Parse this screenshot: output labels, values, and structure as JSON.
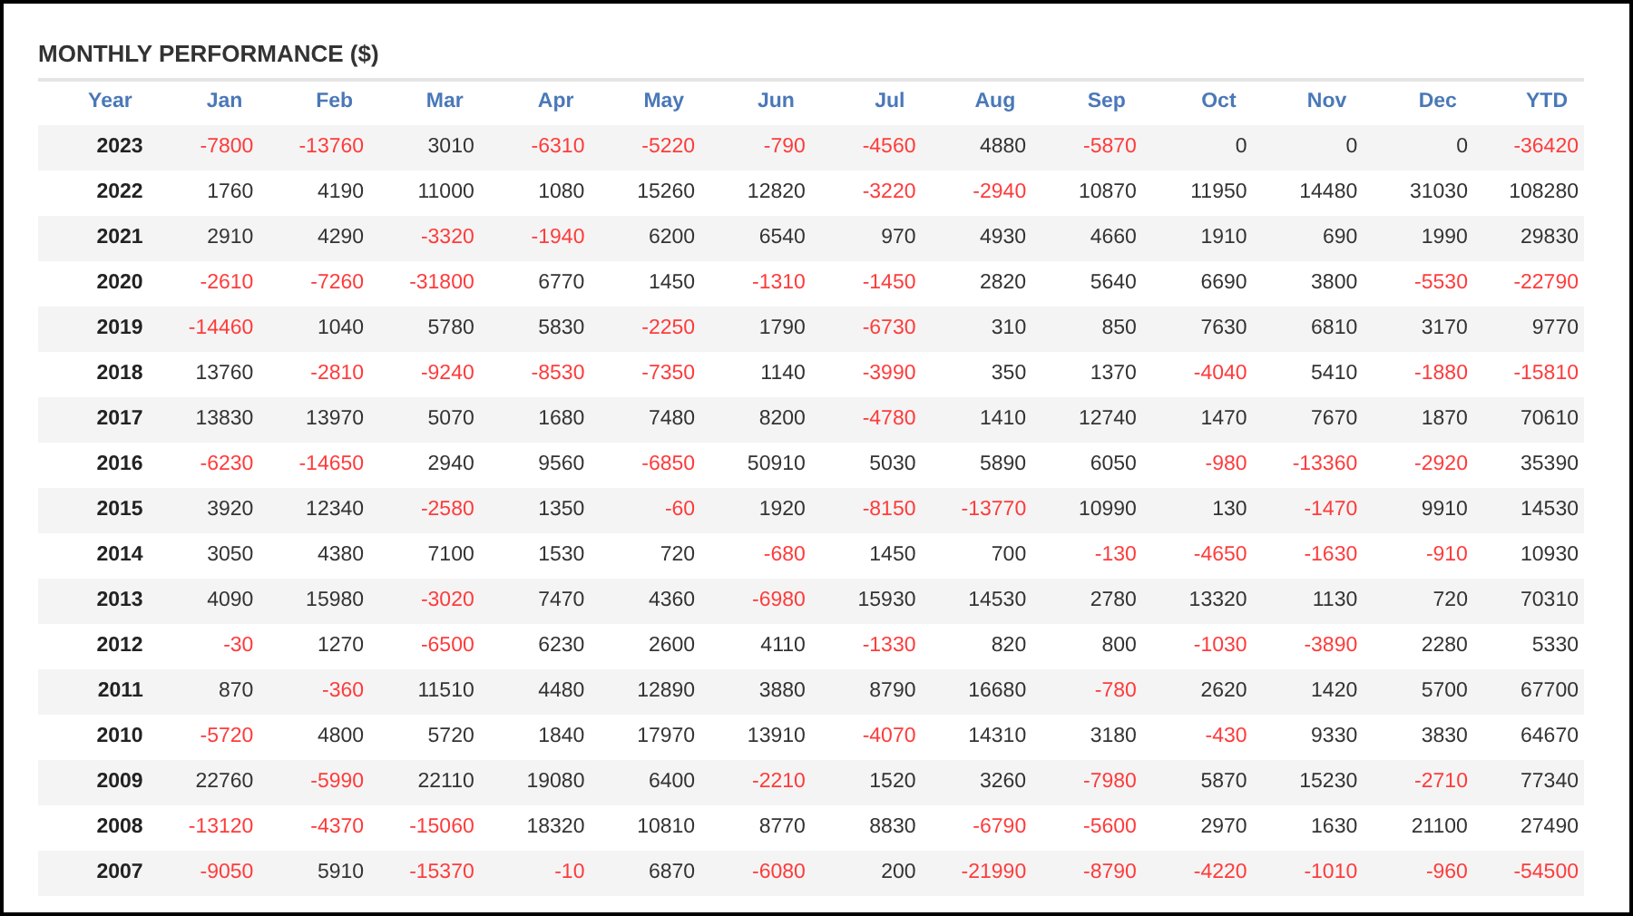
{
  "title": "MONTHLY PERFORMANCE ($)",
  "table": {
    "columns": [
      "Year",
      "Jan",
      "Feb",
      "Mar",
      "Apr",
      "May",
      "Jun",
      "Jul",
      "Aug",
      "Sep",
      "Oct",
      "Nov",
      "Dec",
      "YTD"
    ],
    "rows": [
      {
        "cells": [
          {
            "kind": "year",
            "value": "2023"
          },
          {
            "kind": "amount",
            "value": "-7800",
            "negative": true
          },
          {
            "kind": "amount",
            "value": "-13760",
            "negative": true
          },
          {
            "kind": "amount",
            "value": "3010",
            "negative": false
          },
          {
            "kind": "amount",
            "value": "-6310",
            "negative": true
          },
          {
            "kind": "amount",
            "value": "-5220",
            "negative": true
          },
          {
            "kind": "amount",
            "value": "-790",
            "negative": true
          },
          {
            "kind": "amount",
            "value": "-4560",
            "negative": true
          },
          {
            "kind": "amount",
            "value": "4880",
            "negative": false
          },
          {
            "kind": "amount",
            "value": "-5870",
            "negative": true
          },
          {
            "kind": "amount",
            "value": "0",
            "negative": false
          },
          {
            "kind": "amount",
            "value": "0",
            "negative": false
          },
          {
            "kind": "amount",
            "value": "0",
            "negative": false
          },
          {
            "kind": "amount",
            "value": "-36420",
            "negative": true
          }
        ]
      },
      {
        "cells": [
          {
            "kind": "year",
            "value": "2022"
          },
          {
            "kind": "amount",
            "value": "1760",
            "negative": false
          },
          {
            "kind": "amount",
            "value": "4190",
            "negative": false
          },
          {
            "kind": "amount",
            "value": "11000",
            "negative": false
          },
          {
            "kind": "amount",
            "value": "1080",
            "negative": false
          },
          {
            "kind": "amount",
            "value": "15260",
            "negative": false
          },
          {
            "kind": "amount",
            "value": "12820",
            "negative": false
          },
          {
            "kind": "amount",
            "value": "-3220",
            "negative": true
          },
          {
            "kind": "amount",
            "value": "-2940",
            "negative": true
          },
          {
            "kind": "amount",
            "value": "10870",
            "negative": false
          },
          {
            "kind": "amount",
            "value": "11950",
            "negative": false
          },
          {
            "kind": "amount",
            "value": "14480",
            "negative": false
          },
          {
            "kind": "amount",
            "value": "31030",
            "negative": false
          },
          {
            "kind": "amount",
            "value": "108280",
            "negative": false
          }
        ]
      },
      {
        "cells": [
          {
            "kind": "year",
            "value": "2021"
          },
          {
            "kind": "amount",
            "value": "2910",
            "negative": false
          },
          {
            "kind": "amount",
            "value": "4290",
            "negative": false
          },
          {
            "kind": "amount",
            "value": "-3320",
            "negative": true
          },
          {
            "kind": "amount",
            "value": "-1940",
            "negative": true
          },
          {
            "kind": "amount",
            "value": "6200",
            "negative": false
          },
          {
            "kind": "amount",
            "value": "6540",
            "negative": false
          },
          {
            "kind": "amount",
            "value": "970",
            "negative": false
          },
          {
            "kind": "amount",
            "value": "4930",
            "negative": false
          },
          {
            "kind": "amount",
            "value": "4660",
            "negative": false
          },
          {
            "kind": "amount",
            "value": "1910",
            "negative": false
          },
          {
            "kind": "amount",
            "value": "690",
            "negative": false
          },
          {
            "kind": "amount",
            "value": "1990",
            "negative": false
          },
          {
            "kind": "amount",
            "value": "29830",
            "negative": false
          }
        ]
      },
      {
        "cells": [
          {
            "kind": "year",
            "value": "2020"
          },
          {
            "kind": "amount",
            "value": "-2610",
            "negative": true
          },
          {
            "kind": "amount",
            "value": "-7260",
            "negative": true
          },
          {
            "kind": "amount",
            "value": "-31800",
            "negative": true
          },
          {
            "kind": "amount",
            "value": "6770",
            "negative": false
          },
          {
            "kind": "amount",
            "value": "1450",
            "negative": false
          },
          {
            "kind": "amount",
            "value": "-1310",
            "negative": true
          },
          {
            "kind": "amount",
            "value": "-1450",
            "negative": true
          },
          {
            "kind": "amount",
            "value": "2820",
            "negative": false
          },
          {
            "kind": "amount",
            "value": "5640",
            "negative": false
          },
          {
            "kind": "amount",
            "value": "6690",
            "negative": false
          },
          {
            "kind": "amount",
            "value": "3800",
            "negative": false
          },
          {
            "kind": "amount",
            "value": "-5530",
            "negative": true
          },
          {
            "kind": "amount",
            "value": "-22790",
            "negative": true
          }
        ]
      },
      {
        "cells": [
          {
            "kind": "year",
            "value": "2019"
          },
          {
            "kind": "amount",
            "value": "-14460",
            "negative": true
          },
          {
            "kind": "amount",
            "value": "1040",
            "negative": false
          },
          {
            "kind": "amount",
            "value": "5780",
            "negative": false
          },
          {
            "kind": "amount",
            "value": "5830",
            "negative": false
          },
          {
            "kind": "amount",
            "value": "-2250",
            "negative": true
          },
          {
            "kind": "amount",
            "value": "1790",
            "negative": false
          },
          {
            "kind": "amount",
            "value": "-6730",
            "negative": true
          },
          {
            "kind": "amount",
            "value": "310",
            "negative": false
          },
          {
            "kind": "amount",
            "value": "850",
            "negative": false
          },
          {
            "kind": "amount",
            "value": "7630",
            "negative": false
          },
          {
            "kind": "amount",
            "value": "6810",
            "negative": false
          },
          {
            "kind": "amount",
            "value": "3170",
            "negative": false
          },
          {
            "kind": "amount",
            "value": "9770",
            "negative": false
          }
        ]
      },
      {
        "cells": [
          {
            "kind": "year",
            "value": "2018"
          },
          {
            "kind": "amount",
            "value": "13760",
            "negative": false
          },
          {
            "kind": "amount",
            "value": "-2810",
            "negative": true
          },
          {
            "kind": "amount",
            "value": "-9240",
            "negative": true
          },
          {
            "kind": "amount",
            "value": "-8530",
            "negative": true
          },
          {
            "kind": "amount",
            "value": "-7350",
            "negative": true
          },
          {
            "kind": "amount",
            "value": "1140",
            "negative": false
          },
          {
            "kind": "amount",
            "value": "-3990",
            "negative": true
          },
          {
            "kind": "amount",
            "value": "350",
            "negative": false
          },
          {
            "kind": "amount",
            "value": "1370",
            "negative": false
          },
          {
            "kind": "amount",
            "value": "-4040",
            "negative": true
          },
          {
            "kind": "amount",
            "value": "5410",
            "negative": false
          },
          {
            "kind": "amount",
            "value": "-1880",
            "negative": true
          },
          {
            "kind": "amount",
            "value": "-15810",
            "negative": true
          }
        ]
      },
      {
        "cells": [
          {
            "kind": "year",
            "value": "2017"
          },
          {
            "kind": "amount",
            "value": "13830",
            "negative": false
          },
          {
            "kind": "amount",
            "value": "13970",
            "negative": false
          },
          {
            "kind": "amount",
            "value": "5070",
            "negative": false
          },
          {
            "kind": "amount",
            "value": "1680",
            "negative": false
          },
          {
            "kind": "amount",
            "value": "7480",
            "negative": false
          },
          {
            "kind": "amount",
            "value": "8200",
            "negative": false
          },
          {
            "kind": "amount",
            "value": "-4780",
            "negative": true
          },
          {
            "kind": "amount",
            "value": "1410",
            "negative": false
          },
          {
            "kind": "amount",
            "value": "12740",
            "negative": false
          },
          {
            "kind": "amount",
            "value": "1470",
            "negative": false
          },
          {
            "kind": "amount",
            "value": "7670",
            "negative": false
          },
          {
            "kind": "amount",
            "value": "1870",
            "negative": false
          },
          {
            "kind": "amount",
            "value": "70610",
            "negative": false
          }
        ]
      },
      {
        "cells": [
          {
            "kind": "year",
            "value": "2016"
          },
          {
            "kind": "amount",
            "value": "-6230",
            "negative": true
          },
          {
            "kind": "amount",
            "value": "-14650",
            "negative": true
          },
          {
            "kind": "amount",
            "value": "2940",
            "negative": false
          },
          {
            "kind": "amount",
            "value": "9560",
            "negative": false
          },
          {
            "kind": "amount",
            "value": "-6850",
            "negative": true
          },
          {
            "kind": "amount",
            "value": "50910",
            "negative": false
          },
          {
            "kind": "amount",
            "value": "5030",
            "negative": false
          },
          {
            "kind": "amount",
            "value": "5890",
            "negative": false
          },
          {
            "kind": "amount",
            "value": "6050",
            "negative": false
          },
          {
            "kind": "amount",
            "value": "-980",
            "negative": true
          },
          {
            "kind": "amount",
            "value": "-13360",
            "negative": true
          },
          {
            "kind": "amount",
            "value": "-2920",
            "negative": true
          },
          {
            "kind": "amount",
            "value": "35390",
            "negative": false
          }
        ]
      },
      {
        "cells": [
          {
            "kind": "year",
            "value": "2015"
          },
          {
            "kind": "amount",
            "value": "3920",
            "negative": false
          },
          {
            "kind": "amount",
            "value": "12340",
            "negative": false
          },
          {
            "kind": "amount",
            "value": "-2580",
            "negative": true
          },
          {
            "kind": "amount",
            "value": "1350",
            "negative": false
          },
          {
            "kind": "amount",
            "value": "-60",
            "negative": true
          },
          {
            "kind": "amount",
            "value": "1920",
            "negative": false
          },
          {
            "kind": "amount",
            "value": "-8150",
            "negative": true
          },
          {
            "kind": "amount",
            "value": "-13770",
            "negative": true
          },
          {
            "kind": "amount",
            "value": "10990",
            "negative": false
          },
          {
            "kind": "amount",
            "value": "130",
            "negative": false
          },
          {
            "kind": "amount",
            "value": "-1470",
            "negative": true
          },
          {
            "kind": "amount",
            "value": "9910",
            "negative": false
          },
          {
            "kind": "amount",
            "value": "14530",
            "negative": false
          }
        ]
      },
      {
        "cells": [
          {
            "kind": "year",
            "value": "2014"
          },
          {
            "kind": "amount",
            "value": "3050",
            "negative": false
          },
          {
            "kind": "amount",
            "value": "4380",
            "negative": false
          },
          {
            "kind": "amount",
            "value": "7100",
            "negative": false
          },
          {
            "kind": "amount",
            "value": "1530",
            "negative": false
          },
          {
            "kind": "amount",
            "value": "720",
            "negative": false
          },
          {
            "kind": "amount",
            "value": "-680",
            "negative": true
          },
          {
            "kind": "amount",
            "value": "1450",
            "negative": false
          },
          {
            "kind": "amount",
            "value": "700",
            "negative": false
          },
          {
            "kind": "amount",
            "value": "-130",
            "negative": true
          },
          {
            "kind": "amount",
            "value": "-4650",
            "negative": true
          },
          {
            "kind": "amount",
            "value": "-1630",
            "negative": true
          },
          {
            "kind": "amount",
            "value": "-910",
            "negative": true
          },
          {
            "kind": "amount",
            "value": "10930",
            "negative": false
          }
        ]
      },
      {
        "cells": [
          {
            "kind": "year",
            "value": "2013"
          },
          {
            "kind": "amount",
            "value": "4090",
            "negative": false
          },
          {
            "kind": "amount",
            "value": "15980",
            "negative": false
          },
          {
            "kind": "amount",
            "value": "-3020",
            "negative": true
          },
          {
            "kind": "amount",
            "value": "7470",
            "negative": false
          },
          {
            "kind": "amount",
            "value": "4360",
            "negative": false
          },
          {
            "kind": "amount",
            "value": "-6980",
            "negative": true
          },
          {
            "kind": "amount",
            "value": "15930",
            "negative": false
          },
          {
            "kind": "amount",
            "value": "14530",
            "negative": false
          },
          {
            "kind": "amount",
            "value": "2780",
            "negative": false
          },
          {
            "kind": "amount",
            "value": "13320",
            "negative": false
          },
          {
            "kind": "amount",
            "value": "1130",
            "negative": false
          },
          {
            "kind": "amount",
            "value": "720",
            "negative": false
          },
          {
            "kind": "amount",
            "value": "70310",
            "negative": false
          }
        ]
      },
      {
        "cells": [
          {
            "kind": "year",
            "value": "2012"
          },
          {
            "kind": "amount",
            "value": "-30",
            "negative": true
          },
          {
            "kind": "amount",
            "value": "1270",
            "negative": false
          },
          {
            "kind": "amount",
            "value": "-6500",
            "negative": true
          },
          {
            "kind": "amount",
            "value": "6230",
            "negative": false
          },
          {
            "kind": "amount",
            "value": "2600",
            "negative": false
          },
          {
            "kind": "amount",
            "value": "4110",
            "negative": false
          },
          {
            "kind": "amount",
            "value": "-1330",
            "negative": true
          },
          {
            "kind": "amount",
            "value": "820",
            "negative": false
          },
          {
            "kind": "amount",
            "value": "800",
            "negative": false
          },
          {
            "kind": "amount",
            "value": "-1030",
            "negative": true
          },
          {
            "kind": "amount",
            "value": "-3890",
            "negative": true
          },
          {
            "kind": "amount",
            "value": "2280",
            "negative": false
          },
          {
            "kind": "amount",
            "value": "5330",
            "negative": false
          }
        ]
      },
      {
        "cells": [
          {
            "kind": "year",
            "value": "2011"
          },
          {
            "kind": "amount",
            "value": "870",
            "negative": false
          },
          {
            "kind": "amount",
            "value": "-360",
            "negative": true
          },
          {
            "kind": "amount",
            "value": "11510",
            "negative": false
          },
          {
            "kind": "amount",
            "value": "4480",
            "negative": false
          },
          {
            "kind": "amount",
            "value": "12890",
            "negative": false
          },
          {
            "kind": "amount",
            "value": "3880",
            "negative": false
          },
          {
            "kind": "amount",
            "value": "8790",
            "negative": false
          },
          {
            "kind": "amount",
            "value": "16680",
            "negative": false
          },
          {
            "kind": "amount",
            "value": "-780",
            "negative": true
          },
          {
            "kind": "amount",
            "value": "2620",
            "negative": false
          },
          {
            "kind": "amount",
            "value": "1420",
            "negative": false
          },
          {
            "kind": "amount",
            "value": "5700",
            "negative": false
          },
          {
            "kind": "amount",
            "value": "67700",
            "negative": false
          }
        ]
      },
      {
        "cells": [
          {
            "kind": "year",
            "value": "2010"
          },
          {
            "kind": "amount",
            "value": "-5720",
            "negative": true
          },
          {
            "kind": "amount",
            "value": "4800",
            "negative": false
          },
          {
            "kind": "amount",
            "value": "5720",
            "negative": false
          },
          {
            "kind": "amount",
            "value": "1840",
            "negative": false
          },
          {
            "kind": "amount",
            "value": "17970",
            "negative": false
          },
          {
            "kind": "amount",
            "value": "13910",
            "negative": false
          },
          {
            "kind": "amount",
            "value": "-4070",
            "negative": true
          },
          {
            "kind": "amount",
            "value": "14310",
            "negative": false
          },
          {
            "kind": "amount",
            "value": "3180",
            "negative": false
          },
          {
            "kind": "amount",
            "value": "-430",
            "negative": true
          },
          {
            "kind": "amount",
            "value": "9330",
            "negative": false
          },
          {
            "kind": "amount",
            "value": "3830",
            "negative": false
          },
          {
            "kind": "amount",
            "value": "64670",
            "negative": false
          }
        ]
      },
      {
        "cells": [
          {
            "kind": "year",
            "value": "2009"
          },
          {
            "kind": "amount",
            "value": "22760",
            "negative": false
          },
          {
            "kind": "amount",
            "value": "-5990",
            "negative": true
          },
          {
            "kind": "amount",
            "value": "22110",
            "negative": false
          },
          {
            "kind": "amount",
            "value": "19080",
            "negative": false
          },
          {
            "kind": "amount",
            "value": "6400",
            "negative": false
          },
          {
            "kind": "amount",
            "value": "-2210",
            "negative": true
          },
          {
            "kind": "amount",
            "value": "1520",
            "negative": false
          },
          {
            "kind": "amount",
            "value": "3260",
            "negative": false
          },
          {
            "kind": "amount",
            "value": "-7980",
            "negative": true
          },
          {
            "kind": "amount",
            "value": "5870",
            "negative": false
          },
          {
            "kind": "amount",
            "value": "15230",
            "negative": false
          },
          {
            "kind": "amount",
            "value": "-2710",
            "negative": true
          },
          {
            "kind": "amount",
            "value": "77340",
            "negative": false
          }
        ]
      },
      {
        "cells": [
          {
            "kind": "year",
            "value": "2008"
          },
          {
            "kind": "amount",
            "value": "-13120",
            "negative": true
          },
          {
            "kind": "amount",
            "value": "-4370",
            "negative": true
          },
          {
            "kind": "amount",
            "value": "-15060",
            "negative": true
          },
          {
            "kind": "amount",
            "value": "18320",
            "negative": false
          },
          {
            "kind": "amount",
            "value": "10810",
            "negative": false
          },
          {
            "kind": "amount",
            "value": "8770",
            "negative": false
          },
          {
            "kind": "amount",
            "value": "8830",
            "negative": false
          },
          {
            "kind": "amount",
            "value": "-6790",
            "negative": true
          },
          {
            "kind": "amount",
            "value": "-5600",
            "negative": true
          },
          {
            "kind": "amount",
            "value": "2970",
            "negative": false
          },
          {
            "kind": "amount",
            "value": "1630",
            "negative": false
          },
          {
            "kind": "amount",
            "value": "21100",
            "negative": false
          },
          {
            "kind": "amount",
            "value": "27490",
            "negative": false
          }
        ]
      },
      {
        "cells": [
          {
            "kind": "year",
            "value": "2007"
          },
          {
            "kind": "amount",
            "value": "-9050",
            "negative": true
          },
          {
            "kind": "amount",
            "value": "5910",
            "negative": false
          },
          {
            "kind": "amount",
            "value": "-15370",
            "negative": true
          },
          {
            "kind": "amount",
            "value": "-10",
            "negative": true
          },
          {
            "kind": "amount",
            "value": "6870",
            "negative": false
          },
          {
            "kind": "amount",
            "value": "-6080",
            "negative": true
          },
          {
            "kind": "amount",
            "value": "200",
            "negative": false
          },
          {
            "kind": "amount",
            "value": "-21990",
            "negative": true
          },
          {
            "kind": "amount",
            "value": "-8790",
            "negative": true
          },
          {
            "kind": "amount",
            "value": "-4220",
            "negative": true
          },
          {
            "kind": "amount",
            "value": "-1010",
            "negative": true
          },
          {
            "kind": "amount",
            "value": "-960",
            "negative": true
          },
          {
            "kind": "amount",
            "value": "-54500",
            "negative": true
          }
        ]
      }
    ]
  }
}
